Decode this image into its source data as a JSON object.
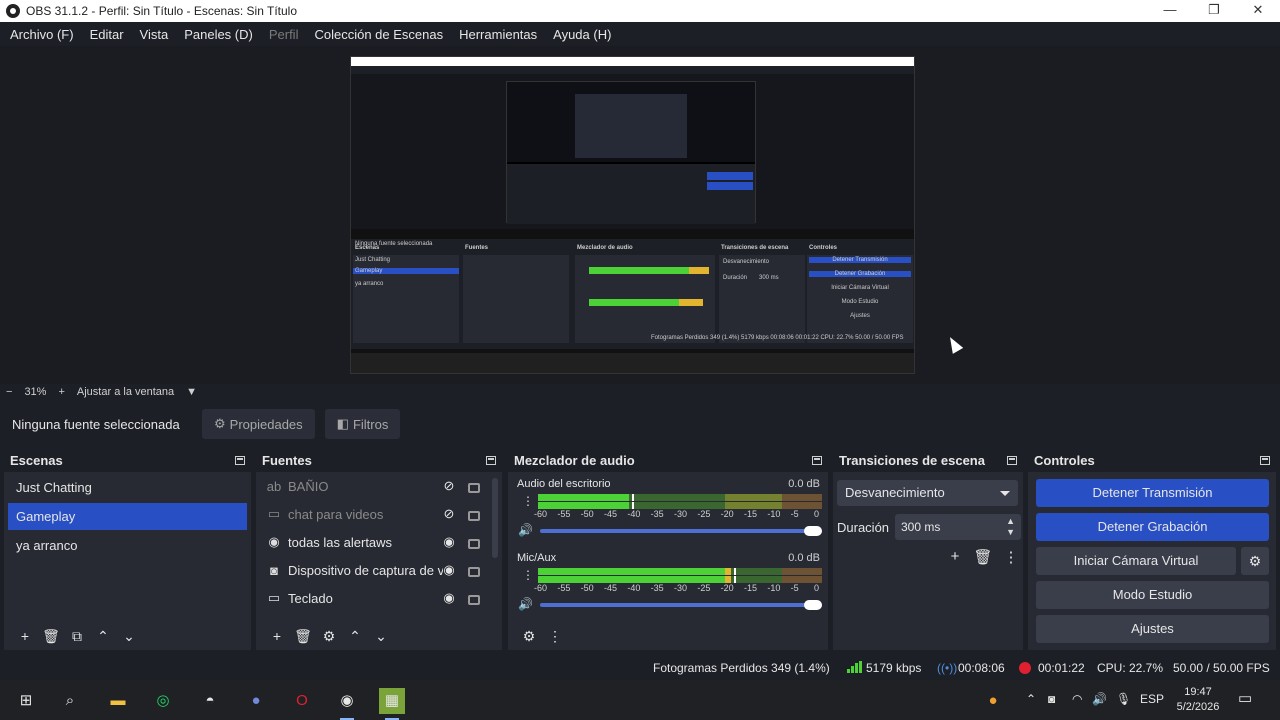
{
  "window": {
    "title": "OBS 31.1.2 - Perfil: Sin Título - Escenas: Sin Título",
    "minimize": "—",
    "maximize": "❐",
    "close": "✕"
  },
  "menu": [
    "Archivo (F)",
    "Editar",
    "Vista",
    "Paneles (D)",
    "Perfil",
    "Colección de Escenas",
    "Herramientas",
    "Ayuda (H)"
  ],
  "menu_disabled_index": 4,
  "preview": {
    "nested_text": {
      "no_source": "Ninguna fuente seleccionada",
      "scenes": "Escenas",
      "sources": "Fuentes",
      "mixer": "Mezclador de audio",
      "transitions": "Transiciones de escena",
      "controls": "Controles",
      "scene1": "Just Chatting",
      "scene2": "Gameplay",
      "scene3": "ya arranco",
      "stop_stream": "Detener Transmisión",
      "stop_rec": "Detener Grabación",
      "virtual_cam": "Iniciar Cámara Virtual",
      "studio": "Modo Estudio",
      "settings": "Ajustes",
      "fade": "Desvanecimiento",
      "duration": "Duración",
      "dur_val": "300 ms",
      "status": "Fotogramas Perdidos 349 (1.4%)   5179 kbps   00:08:06   00:01:22   CPU: 22.7%   50.00 / 50.00 FPS"
    }
  },
  "zoom": {
    "minus": "−",
    "value": "31%",
    "plus": "+",
    "fit": "Ajustar a la ventana",
    "caret": "▼"
  },
  "source_toolbar": {
    "no_selection": "Ninguna fuente seleccionada",
    "properties": "Propiedades",
    "filters": "Filtros"
  },
  "docks": {
    "scenes": {
      "title": "Escenas",
      "items": [
        "Just Chatting",
        "Gameplay",
        "ya arranco"
      ],
      "active_index": 1,
      "footer": [
        "+",
        "🗑",
        "⧉",
        "⌃",
        "⌄"
      ]
    },
    "sources": {
      "title": "Fuentes",
      "items": [
        {
          "name": "BAÑIO",
          "icon": "text-icon",
          "glyph": "ab",
          "visible": false
        },
        {
          "name": "chat para videos",
          "icon": "window-capture-icon",
          "glyph": "▭",
          "visible": false
        },
        {
          "name": "todas las alertaws",
          "icon": "browser-icon",
          "glyph": "◉",
          "visible": true
        },
        {
          "name": "Dispositivo de captura de video",
          "icon": "camera-icon",
          "glyph": "◙",
          "visible": true
        },
        {
          "name": "Teclado",
          "icon": "window-capture-icon",
          "glyph": "▭",
          "visible": true
        }
      ],
      "footer": [
        "+",
        "🗑",
        "⚙",
        "⌃",
        "⌄"
      ]
    },
    "mixer": {
      "title": "Mezclador de audio",
      "channels": [
        {
          "name": "Audio del escritorio",
          "db": "0.0 dB",
          "level": 0.32,
          "peak": 0.33
        },
        {
          "name": "Mic/Aux",
          "db": "0.0 dB",
          "level": 0.68,
          "peak": 0.69
        }
      ],
      "ticks": [
        "-60",
        "-55",
        "-50",
        "-45",
        "-40",
        "-35",
        "-30",
        "-25",
        "-20",
        "-15",
        "-10",
        "-5",
        "0"
      ],
      "footer": [
        "⚙",
        "⋮"
      ]
    },
    "transitions": {
      "title": "Transiciones de escena",
      "selected": "Desvanecimiento",
      "duration_label": "Duración",
      "duration_value": "300 ms",
      "actions": [
        "+",
        "🗑",
        "⋮"
      ]
    },
    "controls": {
      "title": "Controles",
      "stop_stream": "Detener Transmisión",
      "stop_recording": "Detener Grabación",
      "virtual_cam": "Iniciar Cámara Virtual",
      "studio_mode": "Modo Estudio",
      "settings": "Ajustes"
    }
  },
  "status": {
    "dropped_frames": "Fotogramas Perdidos 349 (1.4%)",
    "bitrate": "5179 kbps",
    "stream_time": "00:08:06",
    "rec_time": "00:01:22",
    "cpu": "CPU: 22.7%",
    "fps": "50.00 / 50.00 FPS"
  },
  "taskbar": {
    "lang": "ESP",
    "time": "19:47",
    "date": "5/2/2026"
  },
  "colors": {
    "accent": "#284fc3",
    "panel": "#272a33",
    "background": "#1d1f26",
    "meter_green": "#4cd137",
    "meter_yellow": "#e3b52f",
    "meter_red": "#d12d3d",
    "recording": "#e0202f"
  }
}
